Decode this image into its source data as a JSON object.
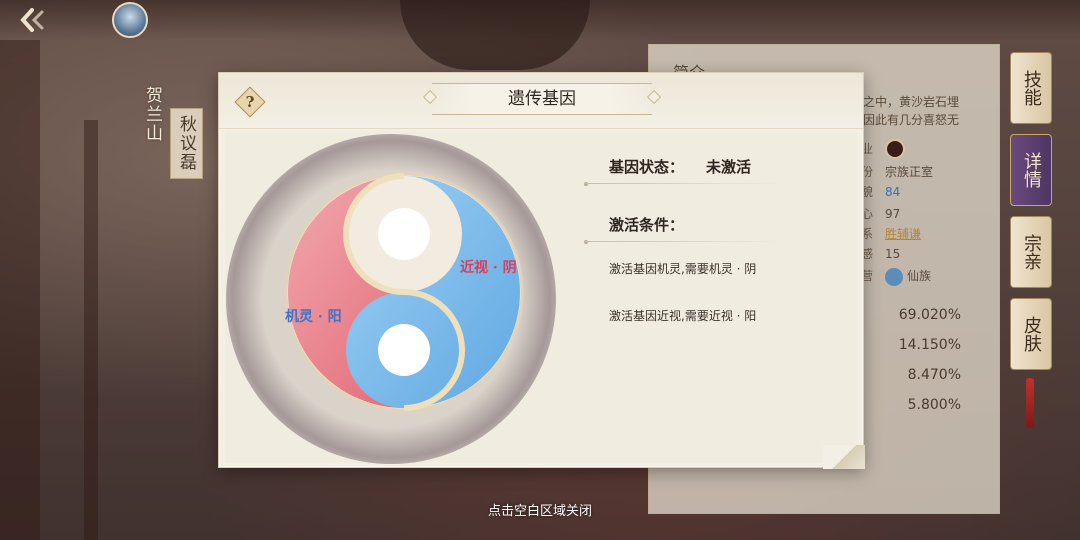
{
  "header": {
    "back_icon": "back-arrow-icon",
    "location": "贺兰山",
    "character_name": "秋议磊"
  },
  "info_panel": {
    "title": "简介",
    "description": "之中，黄沙岩石埋\n因此有几分喜怒无",
    "rows": [
      {
        "label": "职业",
        "value": ""
      },
      {
        "label": "身份",
        "value": "宗族正室"
      },
      {
        "label": "容貌",
        "value": "84"
      },
      {
        "label": "野心",
        "value": "97"
      },
      {
        "label": "关系",
        "value": "胜辅谦"
      },
      {
        "label": "好感",
        "value": "15"
      },
      {
        "label": "阵营",
        "value": "仙族"
      }
    ],
    "percentages": [
      "69.020%",
      "14.150%",
      "8.470%",
      "5.800%"
    ]
  },
  "side_tabs": [
    {
      "label": "技能",
      "active": false
    },
    {
      "label": "详情",
      "active": true
    },
    {
      "label": "宗亲",
      "active": false
    },
    {
      "label": "皮肤",
      "active": false
    }
  ],
  "modal": {
    "help_label": "?",
    "title": "遗传基因",
    "yin_label": "近视 · 阴",
    "yang_label": "机灵 · 阳",
    "status_label": "基因状态：",
    "status_value": "未激活",
    "conditions_heading": "激活条件：",
    "conditions": [
      "激活基因机灵,需要机灵 · 阴",
      "激活基因近视,需要近视 · 阳"
    ],
    "colors": {
      "yin": "#6fb6ea",
      "yang": "#e7707c",
      "background": "#f3efe4"
    }
  },
  "close_hint": "点击空白区域关闭"
}
